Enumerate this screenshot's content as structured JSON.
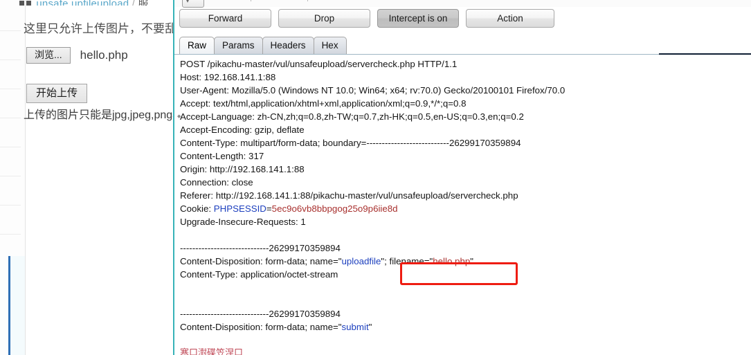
{
  "webpage": {
    "header": {
      "icon": "grid-icon",
      "title": "unsafe upfileupload",
      "separator": "/",
      "subtitle": "服"
    },
    "notice": "这里只允许上传图片，不要乱搞",
    "browse_button": "浏览...",
    "selected_filename": "hello.php",
    "upload_button": "开始上传",
    "hint": "上传的图片只能是jpg,jpeg,png格式"
  },
  "burp": {
    "toolbar": {
      "forward": "Forward",
      "drop": "Drop",
      "intercept": "Intercept is on",
      "action": "Action"
    },
    "tabs": [
      {
        "label": "Raw",
        "active": true
      },
      {
        "label": "Params",
        "active": false
      },
      {
        "label": "Headers",
        "active": false
      },
      {
        "label": "Hex",
        "active": false
      }
    ],
    "request": {
      "request_line": "POST /pikachu-master/vul/unsafeupload/servercheck.php HTTP/1.1",
      "host": "Host: 192.168.141.1:88",
      "user_agent": "User-Agent: Mozilla/5.0 (Windows NT 10.0; Win64; x64; rv:70.0) Gecko/20100101 Firefox/70.0",
      "accept": "Accept: text/html,application/xhtml+xml,application/xml;q=0.9,*/*;q=0.8",
      "accept_language": "Accept-Language: zh-CN,zh;q=0.8,zh-TW;q=0.7,zh-HK;q=0.5,en-US;q=0.3,en;q=0.2",
      "accept_encoding": "Accept-Encoding: gzip, deflate",
      "content_type_header": "Content-Type: multipart/form-data; boundary=---------------------------26299170359894",
      "content_length": "Content-Length: 317",
      "origin": "Origin: http://192.168.141.1:88",
      "connection": "Connection: close",
      "referer": "Referer: http://192.168.141.1:88/pikachu-master/vul/unsafeupload/servercheck.php",
      "cookie_label": "Cookie: ",
      "cookie_name": "PHPSESSID",
      "cookie_eq": "=",
      "cookie_value": "5ec9o6vb8bbpgog25o9p6iie8d",
      "upgrade": "Upgrade-Insecure-Requests: 1",
      "boundary_1": "-----------------------------26299170359894",
      "disposition_file_pre": "Content-Disposition: form-data; name=\"",
      "disposition_file_name": "uploadfile",
      "disposition_file_mid": "\"; filename=\"",
      "disposition_file_value": "hello.php",
      "disposition_file_end": "\"",
      "part_content_type": "Content-Type: application/octet-stream",
      "boundary_2": "-----------------------------26299170359894",
      "disposition_submit_pre": "Content-Disposition: form-data; name=\"",
      "disposition_submit_name": "submit",
      "disposition_submit_end": "\"",
      "body_mojibake": "寒口濧碟笠涅口"
    },
    "annotation": {
      "target": "application/octet-stream",
      "color": "#ee1c11"
    }
  },
  "colors": {
    "accent_teal": "#36b3b8",
    "keyword_blue": "#1c3fbe",
    "value_red": "#a8302e",
    "annotation_red": "#ee1c11",
    "rail_blue": "#2f6fb5"
  }
}
